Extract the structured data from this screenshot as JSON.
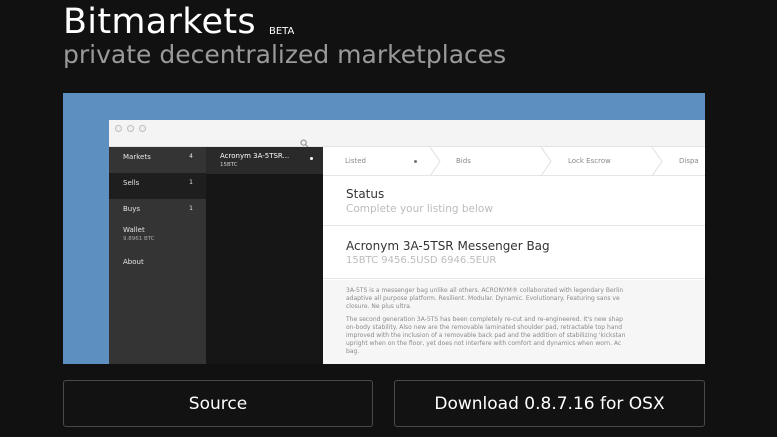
{
  "header": {
    "title": "Bitmarkets",
    "badge": "BETA",
    "tagline": "private decentralized marketplaces"
  },
  "app": {
    "sidebar": {
      "items": [
        {
          "label": "Markets",
          "count": "4"
        },
        {
          "label": "Sells",
          "count": "1"
        },
        {
          "label": "Buys",
          "count": "1"
        },
        {
          "label": "Wallet",
          "sub": "9.8961 BTC"
        },
        {
          "label": "About"
        }
      ]
    },
    "list": {
      "selected": {
        "title": "Acronym 3A-5TSR...",
        "sub": "15BTC"
      }
    },
    "steps": [
      "Listed",
      "Bids",
      "Lock Escrow",
      "Dispa"
    ],
    "status": {
      "title": "Status",
      "subtitle": "Complete your listing below"
    },
    "item": {
      "title": "Acronym 3A-5TSR Messenger Bag",
      "price": "15BTC 9456.5USD 6946.5EUR"
    },
    "description": [
      "3A-5TS is a messenger bag unlike all others. ACRONYM® collaborated with legendary Berlin",
      "adaptive all purpose platform. Resilient. Modular. Dynamic. Evolutionary. Featuring sans ve",
      "closure. Ne plus ultra.",
      "The second generation 3A-5TS has been completely re-cut and re-engineered. It's new shap",
      "on-body stability. Also new are the removable laminated shoulder pad, retractable top hand",
      "improved with the inclusion of a removable back pad and the addition of stabilizing 'kickstan",
      "upright when on the floor, yet does not interfere with comfort and dynamics when worn. Ac",
      "bag."
    ]
  },
  "buttons": {
    "source": "Source",
    "download": "Download 0.8.7.16 for OSX"
  },
  "colors": {
    "background": "#111111",
    "screenshot_bg": "#5d8fc1",
    "sidebar": "#343434",
    "list_pane": "#161616",
    "tagline": "#9a9a9a"
  }
}
